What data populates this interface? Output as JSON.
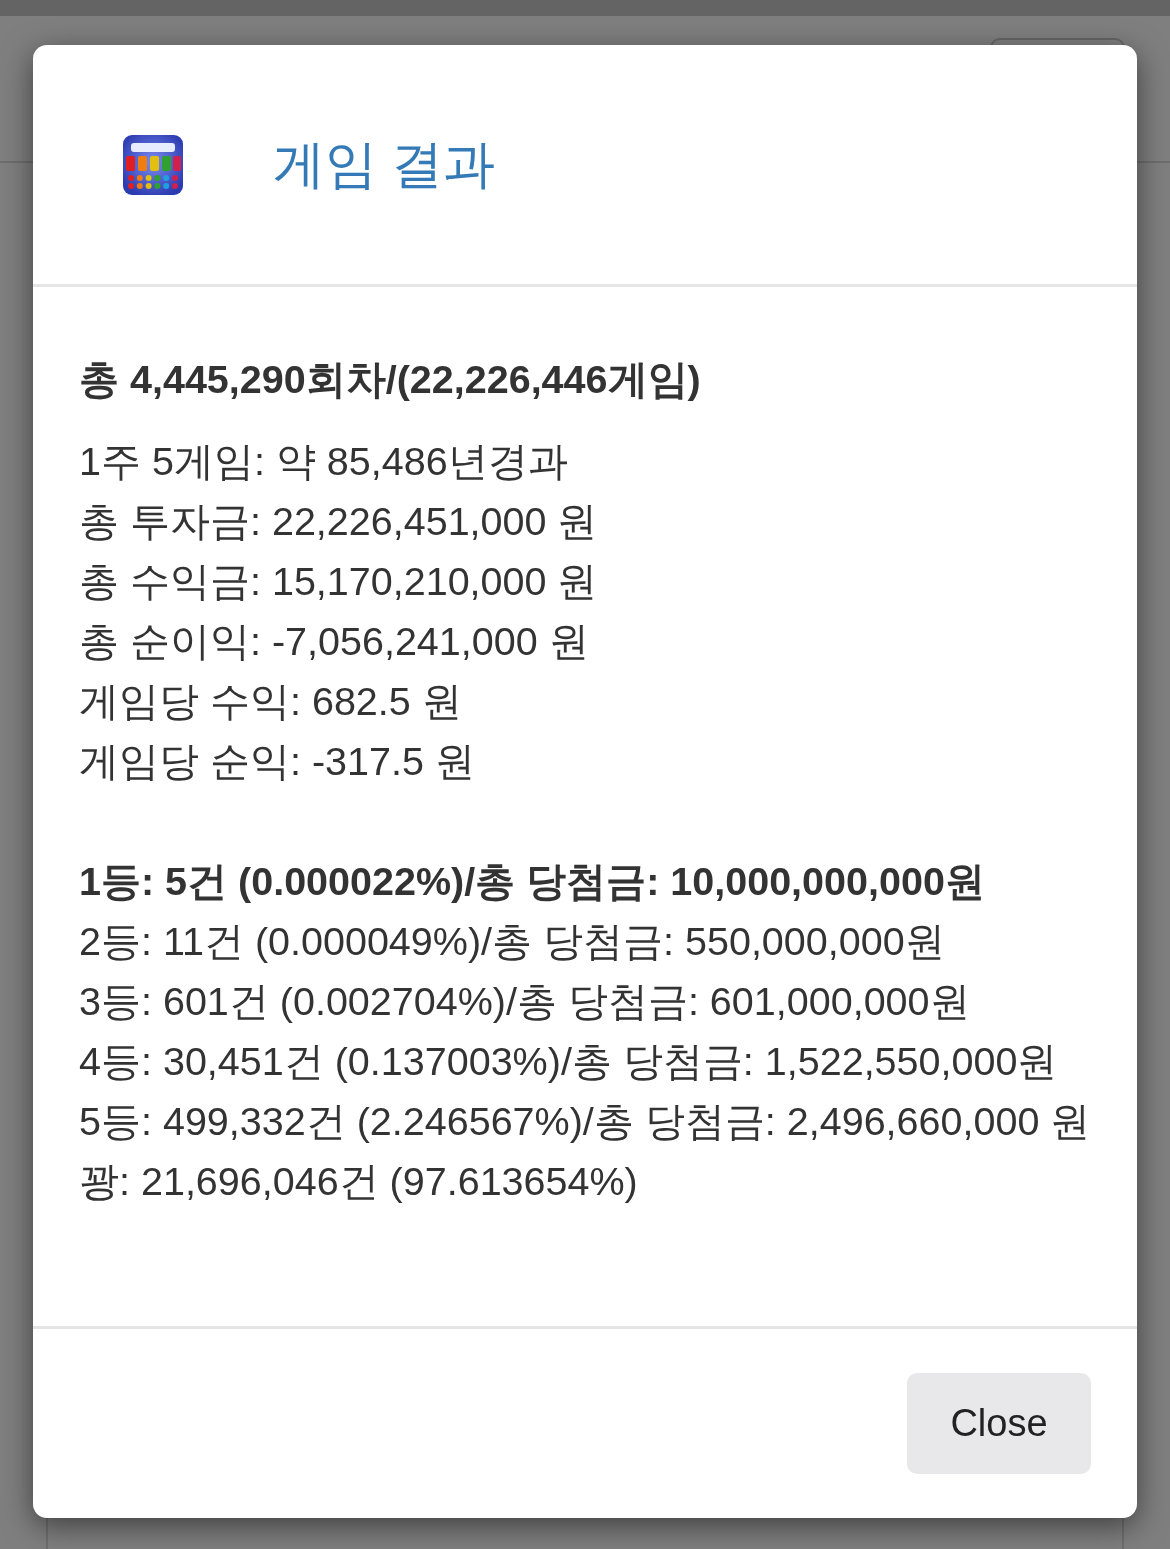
{
  "modal": {
    "title": "게임 결과",
    "summary": "총 4,445,290회차/(22,226,446게임)",
    "stats": [
      "1주 5게임: 약 85,486년경과",
      "총 투자금: 22,226,451,000 원",
      "총 수익금: 15,170,210,000 원",
      "총 순이익: -7,056,241,000 원",
      "게임당 수익: 682.5 원",
      "게임당 순익: -317.5 원"
    ],
    "ranks": [
      {
        "text": "1등: 5건 (0.000022%)/총 당첨금: 10,000,000,000원",
        "bold": true
      },
      {
        "text": "2등: 11건 (0.000049%)/총 당첨금: 550,000,000원",
        "bold": false
      },
      {
        "text": "3등: 601건 (0.002704%)/총 당첨금: 601,000,000원",
        "bold": false
      },
      {
        "text": "4등: 30,451건 (0.137003%)/총 당첨금: 1,522,550,000원",
        "bold": false
      },
      {
        "text": "5등: 499,332건 (2.246567%)/총 당첨금: 2,496,660,000 원",
        "bold": false
      },
      {
        "text": "꽝: 21,696,046건 (97.613654%)",
        "bold": false
      }
    ],
    "close_button": "Close"
  }
}
